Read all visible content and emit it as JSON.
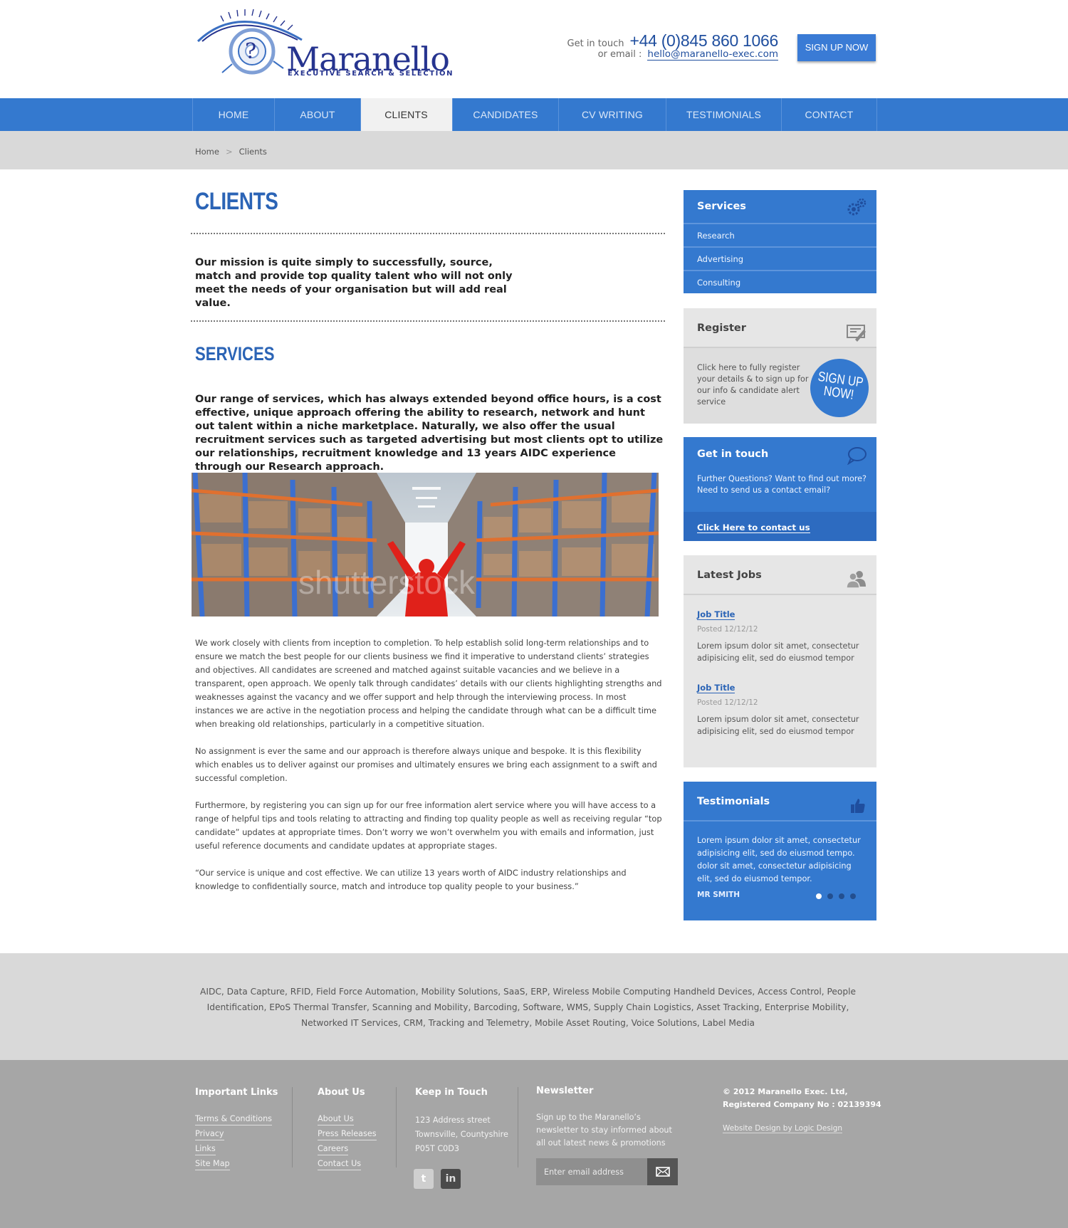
{
  "header": {
    "logo_name": "Maranello",
    "logo_tagline": "EXECUTIVE SEARCH & SELECTION",
    "get_in_touch_label": "Get in touch",
    "phone": "+44 (0)845 860 1066",
    "email_label": "or email :",
    "email": "hello@maranello-exec.com",
    "signup_button": "SIGN UP NOW"
  },
  "nav": {
    "items": [
      {
        "label": "HOME"
      },
      {
        "label": "ABOUT"
      },
      {
        "label": "CLIENTS"
      },
      {
        "label": "CANDIDATES"
      },
      {
        "label": "CV WRITING"
      },
      {
        "label": "TESTIMONIALS"
      },
      {
        "label": "CONTACT"
      }
    ],
    "active": "CLIENTS"
  },
  "breadcrumb": {
    "home": "Home",
    "separator": ">",
    "current": "Clients"
  },
  "main": {
    "title": "CLIENTS",
    "mission": "Our mission is quite simply to successfully, source, match and provide top quality talent who will not only meet the needs of your organisation but will add real value.",
    "services_title": "SERVICES",
    "services_intro": "Our range of services, which has always extended beyond office hours, is a cost effective, unique approach offering the ability to research, network and hunt out talent within a niche marketplace.  Naturally, we also offer the usual recruitment services such as targeted advertising but most clients opt to utilize our relationships, recruitment knowledge and 13 years AIDC experience through our Research approach.",
    "hero_watermark": "shutterstock",
    "paragraphs": [
      "We work closely with clients from inception to completion.  To help establish solid long-term relationships and to ensure we match the best people for our clients business we find it imperative to understand clients’ strategies and objectives. All candidates are screened and matched against suitable vacancies and we believe in a transparent, open approach. We openly talk through candidates’ details with our clients highlighting strengths and weaknesses against the vacancy and we offer support and help through the interviewing process.  In most instances we are active in the negotiation process and helping the candidate through what can be a difficult time when breaking old relationships, particularly in a competitive situation.",
      "No assignment is ever the same and our approach is therefore always unique and bespoke.  It is this flexibility which enables us to deliver against our promises and ultimately ensures we bring each assignment to a swift and successful completion.",
      "Furthermore, by registering you can sign up for our free information alert service where you will have access to a range of helpful tips and tools relating to attracting and finding top quality people as well as receiving regular “top candidate” updates at appropriate times.  Don’t worry we won’t overwhelm you with emails and information, just useful reference documents and candidate updates at appropriate stages.",
      "“Our service is unique and cost effective.  We can utilize 13 years worth of AIDC industry relationships and knowledge to confidentially source, match and introduce top quality people to your business.”"
    ]
  },
  "sidebar": {
    "services": {
      "title": "Services",
      "items": [
        {
          "label": "Research"
        },
        {
          "label": "Advertising"
        },
        {
          "label": "Consulting"
        }
      ]
    },
    "register": {
      "title": "Register",
      "text": "Click here to fully register your details & to sign up for our info & candidate alert service",
      "badge_line1": "SIGN UP",
      "badge_line2": "NOW!"
    },
    "get_in_touch": {
      "title": "Get in touch",
      "text": "Further Questions? Want to find out more? Need to send us a contact email?",
      "link": "Click Here to contact us"
    },
    "latest_jobs": {
      "title": "Latest Jobs",
      "jobs": [
        {
          "title": "Job Title",
          "posted": "Posted 12/12/12",
          "desc": "Lorem ipsum dolor sit amet, consectetur adipisicing elit, sed do eiusmod tempor"
        },
        {
          "title": "Job Title",
          "posted": "Posted 12/12/12",
          "desc": "Lorem ipsum dolor sit amet, consectetur adipisicing elit, sed do eiusmod tempor"
        }
      ]
    },
    "testimonials": {
      "title": "Testimonials",
      "quote": "Lorem ipsum dolor sit amet, consectetur adipisicing elit, sed do eiusmod tempo. dolor sit amet, consectetur adipisicing elit, sed do eiusmod tempor.",
      "author": "MR SMITH",
      "slide_count": 4,
      "active_slide": 1
    }
  },
  "keywords": "AIDC, Data Capture, RFID, Field Force Automation, Mobility Solutions, SaaS, ERP, Wireless Mobile Computing Handheld Devices, Access Control, People Identification, EPoS Thermal Transfer, Scanning and Mobility, Barcoding, Software,  WMS, Supply Chain Logistics, Asset Tracking, Enterprise Mobility, Networked IT Services, CRM, Tracking and Telemetry, Mobile Asset Routing, Voice Solutions, Label Media",
  "footer": {
    "important_links": {
      "title": "Important Links",
      "links": [
        {
          "label": "Terms & Conditions"
        },
        {
          "label": "Privacy"
        },
        {
          "label": "Links"
        },
        {
          "label": "Site Map"
        }
      ]
    },
    "about_us": {
      "title": "About Us",
      "links": [
        {
          "label": "About Us"
        },
        {
          "label": "Press Releases"
        },
        {
          "label": "Careers"
        },
        {
          "label": "Contact Us"
        }
      ]
    },
    "keep_in_touch": {
      "title": "Keep in Touch",
      "address": [
        "123 Address street",
        "Townsville, Countyshire",
        "P05T C0D3"
      ],
      "social": [
        {
          "name": "twitter",
          "glyph": "t"
        },
        {
          "name": "linkedin",
          "glyph": "in"
        }
      ]
    },
    "newsletter": {
      "title": "Newsletter",
      "text": "Sign up to the Maranello’s newsletter to stay informed about all out latest news & promotions",
      "placeholder": "Enter email address"
    },
    "copyright_line1": "© 2012 Maranello Exec. Ltd,",
    "copyright_line2": "Registered Company No : 02139394",
    "credit": "Website Design by Logic Design"
  },
  "colors": {
    "brand_blue": "#3479cf",
    "logo_navy": "#26348f",
    "footer_grey": "#a6a6a6",
    "band_grey": "#d9d9d9"
  }
}
